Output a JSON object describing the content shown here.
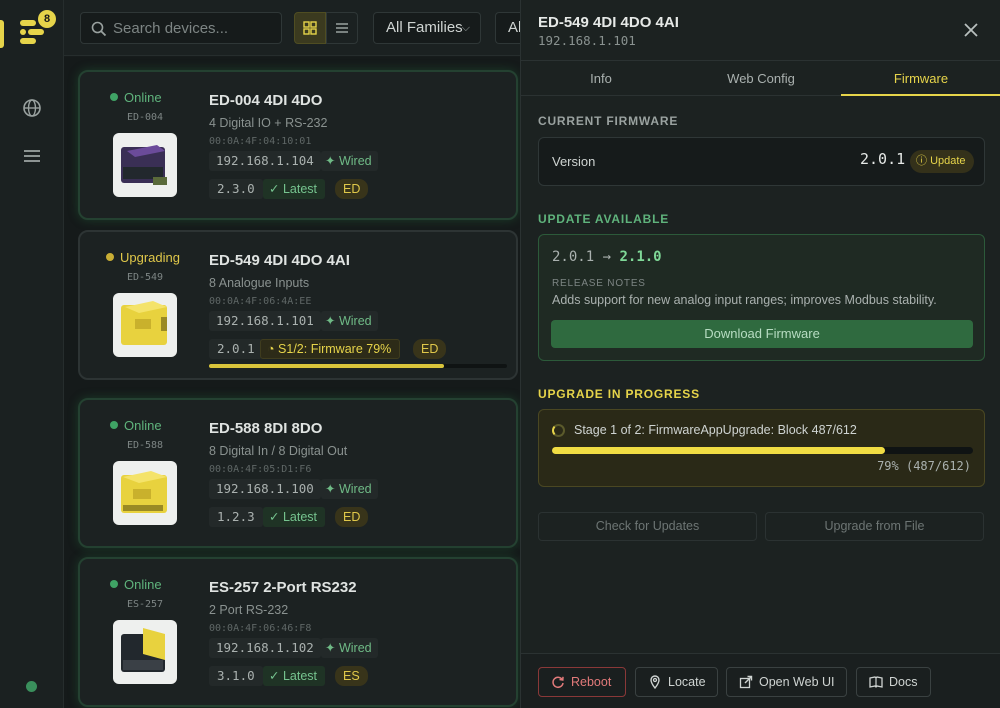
{
  "rail": {
    "badge_count": "8"
  },
  "topbar": {
    "search_placeholder": "Search devices...",
    "family_filter": "All Families",
    "second_filter": "Al"
  },
  "devices": [
    {
      "status": "Online",
      "model": "ED-004",
      "name": "ED-004 4DI 4DO",
      "description": "4 Digital IO + RS-232",
      "mac": "00:0A:4F:04:10:01",
      "ip": "192.168.1.104",
      "link": "Wired",
      "firmware": "2.3.0",
      "fw_state": "Latest",
      "family": "ED"
    },
    {
      "status": "Upgrading",
      "model": "ED-549",
      "name": "ED-549 4DI 4DO 4AI",
      "description": "8 Analogue Inputs",
      "mac": "00:0A:4F:06:4A:EE",
      "ip": "192.168.1.101",
      "link": "Wired",
      "firmware": "2.0.1",
      "fw_state": "S1/2: Firmware 79%",
      "family": "ED",
      "progress": 0.79
    },
    {
      "status": "Online",
      "model": "ED-588",
      "name": "ED-588 8DI 8DO",
      "description": "8 Digital In / 8 Digital Out",
      "mac": "00:0A:4F:05:D1:F6",
      "ip": "192.168.1.100",
      "link": "Wired",
      "firmware": "1.2.3",
      "fw_state": "Latest",
      "family": "ED"
    },
    {
      "status": "Online",
      "model": "ES-257",
      "name": "ES-257 2-Port RS232",
      "description": "2 Port RS-232",
      "mac": "00:0A:4F:06:46:F8",
      "ip": "192.168.1.102",
      "link": "Wired",
      "firmware": "3.1.0",
      "fw_state": "Latest",
      "family": "ES"
    }
  ],
  "drawer": {
    "title": "ED-549 4DI 4DO 4AI",
    "subtitle": "192.168.1.101",
    "tabs": [
      "Info",
      "Web Config",
      "Firmware"
    ],
    "active_tab": "Firmware",
    "current": {
      "heading": "CURRENT FIRMWARE",
      "version_label": "Version",
      "version": "2.0.1",
      "update_badge": "Update"
    },
    "available": {
      "heading": "UPDATE AVAILABLE",
      "from": "2.0.1",
      "arrow": "→",
      "to": "2.1.0",
      "notes_heading": "RELEASE NOTES",
      "notes": "Adds support for new analog input ranges; improves Modbus stability.",
      "download_label": "Download Firmware"
    },
    "progress": {
      "heading": "UPGRADE IN PROGRESS",
      "stage_text": "Stage 1 of 2: FirmwareAppUpgrade: Block 487/612",
      "fraction": 0.79,
      "percent_text": "79% (487/612)"
    },
    "actions": {
      "check_label": "Check for Updates",
      "file_label": "Upgrade from File"
    },
    "footer": {
      "reboot": "Reboot",
      "locate": "Locate",
      "open_web": "Open Web UI",
      "docs": "Docs"
    }
  },
  "colors": {
    "accent": "#e6d44a",
    "online": "#3fa365",
    "danger": "#e27a7a"
  }
}
